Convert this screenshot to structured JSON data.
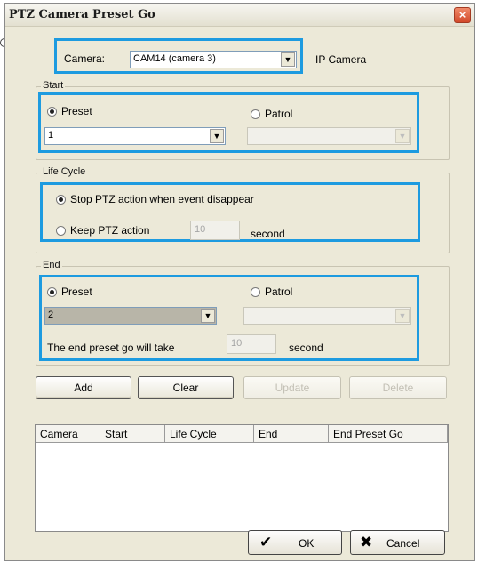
{
  "window": {
    "title": "PTZ Camera Preset Go",
    "close_glyph": "×"
  },
  "camera": {
    "label": "Camera:",
    "selected": "CAM14 (camera 3)",
    "type_label": "IP Camera"
  },
  "start": {
    "group_label": "Start",
    "preset_label": "Preset",
    "patrol_label": "Patrol",
    "preset_value": "1",
    "patrol_value": "",
    "selected_mode": "Preset"
  },
  "life_cycle": {
    "group_label": "Life Cycle",
    "option1": "Stop PTZ action when event disappear",
    "option2": "Keep PTZ action",
    "keep_seconds": "10",
    "unit": "second",
    "selected": "option1"
  },
  "end": {
    "group_label": "End",
    "preset_label": "Preset",
    "patrol_label": "Patrol",
    "preset_value": "2",
    "patrol_value": "",
    "selected_mode": "Preset",
    "take_label": "The end preset go will take",
    "take_seconds": "10",
    "unit": "second"
  },
  "actions": {
    "add": "Add",
    "clear": "Clear",
    "update": "Update",
    "delete": "Delete"
  },
  "table": {
    "columns": [
      "Camera",
      "Start",
      "Life Cycle",
      "End",
      "End Preset Go"
    ],
    "rows": []
  },
  "footer": {
    "ok": "OK",
    "cancel": "Cancel"
  },
  "colors": {
    "highlight": "#1d9be0",
    "dialog_bg": "#ece9d8"
  }
}
